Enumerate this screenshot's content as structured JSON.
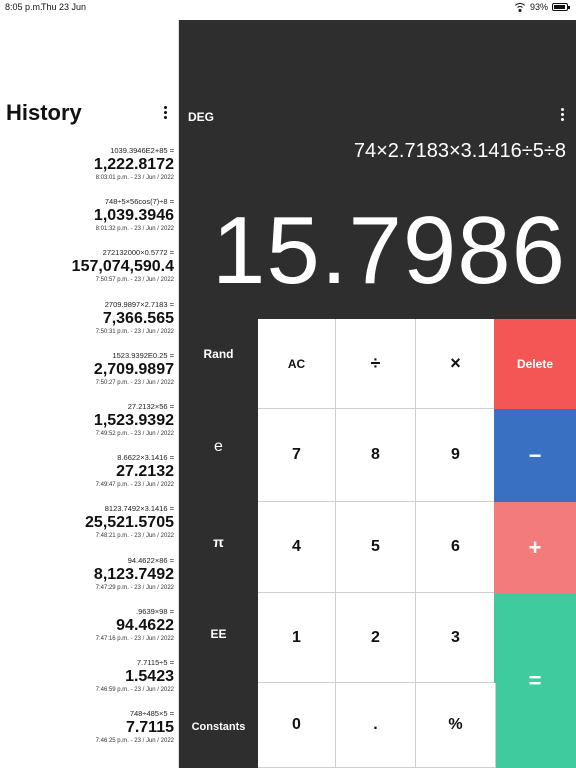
{
  "status": {
    "time": "8:05 p.m.",
    "date": "Thu 23 Jun",
    "battery": "93%"
  },
  "history": {
    "title": "History",
    "entries": [
      {
        "expr": "1039.3946E2+85 =",
        "result": "1,222.8172",
        "stamp": "8:03:01 p.m. - 23 / Jun / 2022"
      },
      {
        "expr": "748÷5×56cos(7)÷8 =",
        "result": "1,039.3946",
        "stamp": "8:01:32 p.m. - 23 / Jun / 2022"
      },
      {
        "expr": "272132000×0.5772 =",
        "result": "157,074,590.4",
        "stamp": "7:50:57 p.m. - 23 / Jun / 2022"
      },
      {
        "expr": "2709.9897×2.7183 =",
        "result": "7,366.565",
        "stamp": "7:50:31 p.m. - 23 / Jun / 2022"
      },
      {
        "expr": "1523.9392E0.25 =",
        "result": "2,709.9897",
        "stamp": "7:50:27 p.m. - 23 / Jun / 2022"
      },
      {
        "expr": "27.2132×56 =",
        "result": "1,523.9392",
        "stamp": "7:49:52 p.m. - 23 / Jun / 2022"
      },
      {
        "expr": "8.6622×3.1416 =",
        "result": "27.2132",
        "stamp": "7:49:47 p.m. - 23 / Jun / 2022"
      },
      {
        "expr": "8123.7492×3.1416 =",
        "result": "25,521.5705",
        "stamp": "7:48:21 p.m. - 23 / Jun / 2022"
      },
      {
        "expr": "94.4622×86 =",
        "result": "8,123.7492",
        "stamp": "7:47:29 p.m. - 23 / Jun / 2022"
      },
      {
        "expr": ".9639×98 =",
        "result": "94.4622",
        "stamp": "7:47:16 p.m. - 23 / Jun / 2022"
      },
      {
        "expr": "7.7115÷5 =",
        "result": "1.5423",
        "stamp": "7:46:59 p.m. - 23 / Jun / 2022"
      },
      {
        "expr": "748÷485×5 =",
        "result": "7.7115",
        "stamp": "7:46:25 p.m. - 23 / Jun / 2022"
      }
    ]
  },
  "calculator": {
    "mode": "DEG",
    "expression": "74×2.7183×3.1416÷5÷8",
    "display": "15.7986",
    "left_keys": [
      "Rand",
      "e",
      "π",
      "EE",
      "Constants"
    ],
    "keys": {
      "ac": "AC",
      "divide": "÷",
      "multiply": "×",
      "delete": "Delete",
      "seven": "7",
      "eight": "8",
      "nine": "9",
      "minus": "−",
      "four": "4",
      "five": "5",
      "six": "6",
      "plus": "+",
      "one": "1",
      "two": "2",
      "three": "3",
      "equals": "=",
      "zero": "0",
      "dot": ".",
      "percent": "%"
    }
  }
}
